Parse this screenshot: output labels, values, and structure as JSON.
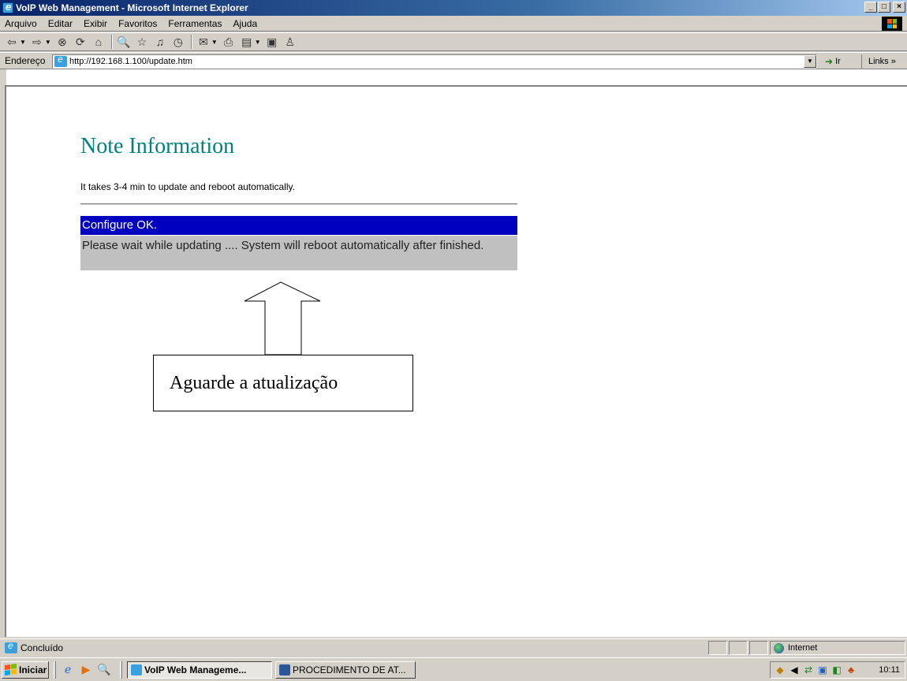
{
  "window": {
    "title": "VoIP Web Management - Microsoft Internet Explorer",
    "minimize": "_",
    "maximize": "□",
    "close": "×"
  },
  "menu": {
    "items": [
      "Arquivo",
      "Editar",
      "Exibir",
      "Favoritos",
      "Ferramentas",
      "Ajuda"
    ]
  },
  "toolbar": {
    "icons": [
      "back-icon",
      "forward-icon",
      "stop-icon",
      "refresh-icon",
      "home-icon",
      "search-icon",
      "favorites-icon",
      "history-icon",
      "media-icon",
      "mail-icon",
      "print-icon",
      "edit-icon",
      "discuss-icon",
      "messenger-icon"
    ]
  },
  "address": {
    "label": "Endereço",
    "url": "http://192.168.1.100/update.htm",
    "go_label": "Ir",
    "links_label": "Links »"
  },
  "page": {
    "title": "Note Information",
    "subtitle": "It takes 3-4 min to update and reboot automatically.",
    "status_ok": "Configure OK.",
    "status_wait": "Please wait while updating .... System will reboot automatically after finished.",
    "callout": "Aguarde a atualização"
  },
  "statusbar": {
    "text": "Concluído",
    "zone": "Internet"
  },
  "taskbar": {
    "start_label": "Iniciar",
    "tasks": [
      {
        "label": "VoIP Web Manageme...",
        "active": true
      },
      {
        "label": "PROCEDIMENTO DE AT...",
        "active": false
      }
    ],
    "clock": "10:11"
  },
  "colors": {
    "title_teal": "#008080",
    "ok_bar": "#0000c0",
    "wait_bar": "#c0c0c0"
  }
}
